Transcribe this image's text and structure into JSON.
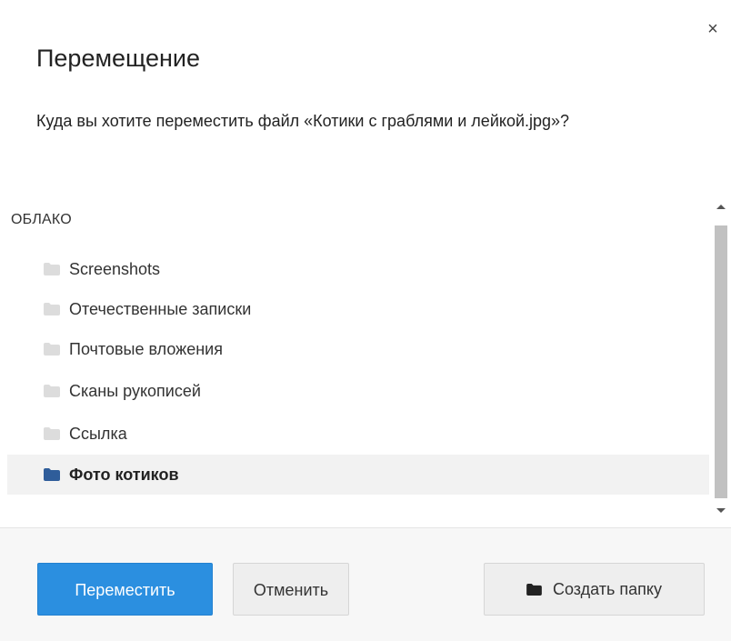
{
  "dialog": {
    "title": "Перемещение",
    "close_glyph": "×",
    "question": "Куда вы хотите переместить файл «Котики с граблями и лейкой.jpg»?"
  },
  "tree": {
    "root_label": "ОБЛАКО",
    "folders": [
      {
        "label": "Screenshots",
        "icon": "folder-icon",
        "selected": false
      },
      {
        "label": "Отечественные записки",
        "icon": "folder-icon",
        "selected": false
      },
      {
        "label": "Почтовые вложения",
        "icon": "folder-icon",
        "selected": false
      },
      {
        "label": "Сканы рукописей",
        "icon": "folder-icon",
        "selected": false
      },
      {
        "label": "Ссылка",
        "icon": "folder-icon",
        "selected": false
      },
      {
        "label": "Фото котиков",
        "icon": "folder-icon",
        "selected": true
      }
    ]
  },
  "footer": {
    "move_label": "Переместить",
    "cancel_label": "Отменить",
    "create_folder_label": "Создать папку",
    "create_folder_icon": "folder-icon"
  },
  "colors": {
    "primary": "#2b8fe0",
    "folder_inactive": "#dcdcdc",
    "folder_active": "#2f5d9a",
    "selected_row": "#f2f2f2"
  }
}
